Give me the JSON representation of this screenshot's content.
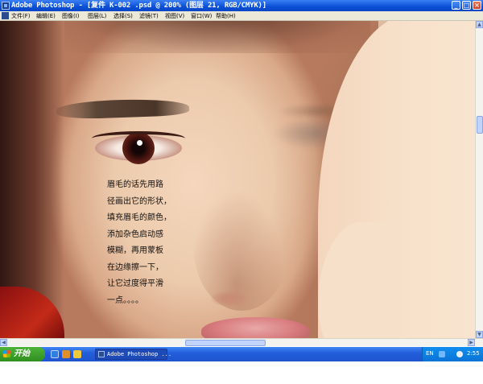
{
  "window": {
    "title": "Adobe Photoshop - [复件 K-002 .psd @ 200% (图层 21, RGB/CMYK)]",
    "controls": {
      "minimize": "_",
      "maximize": "□",
      "close": "×"
    }
  },
  "menubar": {
    "items": [
      {
        "label": "文件(F)"
      },
      {
        "label": "编辑(E)"
      },
      {
        "label": "图像(I)"
      },
      {
        "label": "图层(L)"
      },
      {
        "label": "选择(S)"
      },
      {
        "label": "滤镜(T)"
      },
      {
        "label": "视图(V)"
      },
      {
        "label": "窗口(W)"
      },
      {
        "label": "帮助(H)"
      }
    ]
  },
  "canvas": {
    "caption_lines": [
      "眉毛的话先用路",
      "径画出它的形状，",
      "填充眉毛的颜色，",
      "添加杂色启动感",
      "模糊，再用蒙板",
      "在边缘擦一下，",
      "让它过度得平滑",
      "一点。。。。"
    ]
  },
  "taskbar": {
    "start_label": "开始",
    "task_label": "Adobe Photoshop ...",
    "tray": {
      "language": "EN",
      "time": "2:55"
    }
  },
  "colors": {
    "titlebar": "#0a4fd6",
    "taskbar": "#245edb",
    "start": "#3c9f29",
    "menubar": "#ece9d8"
  },
  "icons": [
    "photoshop-icon",
    "windows-flag-icon",
    "ie-icon",
    "media-player-icon",
    "folder-icon",
    "help-icon",
    "volume-icon"
  ]
}
